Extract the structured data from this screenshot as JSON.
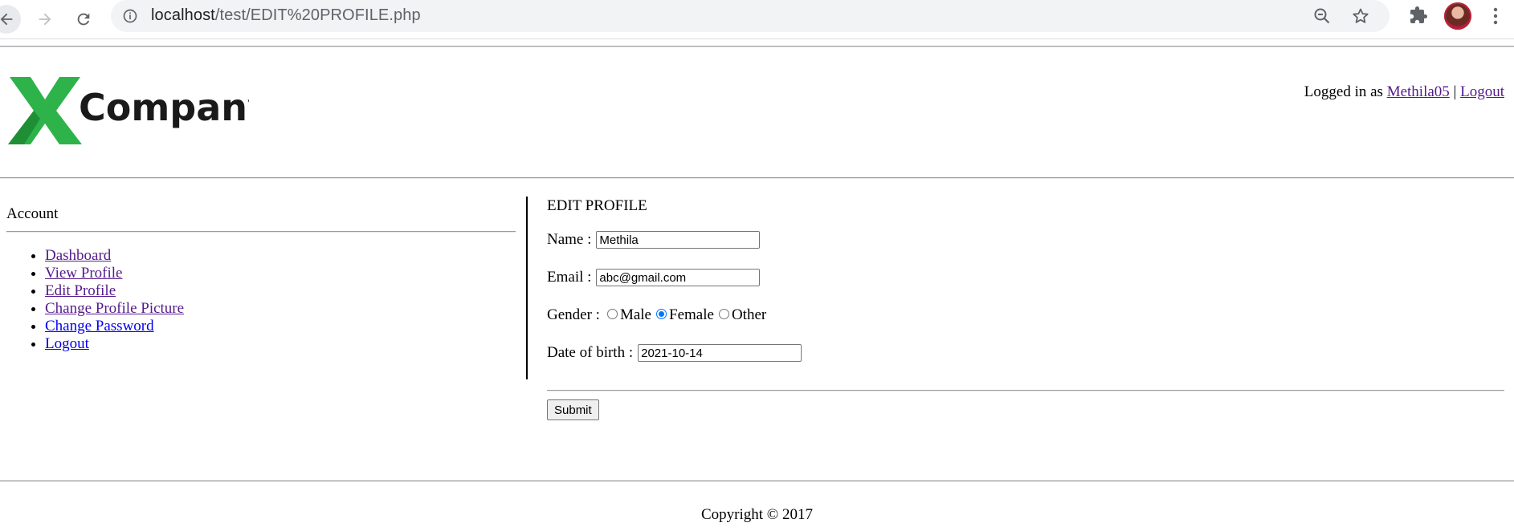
{
  "browser": {
    "url_host": "localhost",
    "url_path": "/test/EDIT%20PROFILE.php",
    "icons": [
      "back-arrow-icon",
      "forward-arrow-icon",
      "reload-icon",
      "info-icon",
      "zoom-out-icon",
      "star-icon",
      "extensions-icon",
      "profile-avatar",
      "menu-icon"
    ]
  },
  "header": {
    "logo_text": "Company",
    "logged_in_prefix": "Logged in as",
    "username": "Methila05",
    "separator": "|",
    "logout_label": "Logout"
  },
  "sidebar": {
    "title": "Account",
    "items": [
      {
        "label": "Dashboard"
      },
      {
        "label": "View Profile"
      },
      {
        "label": "Edit Profile"
      },
      {
        "label": "Change Profile Picture"
      },
      {
        "label": "Change Password"
      },
      {
        "label": "Logout"
      }
    ]
  },
  "form": {
    "title": "EDIT PROFILE",
    "name_label": "Name :",
    "name_value": "Methila",
    "email_label": "Email :",
    "email_value": "abc@gmail.com",
    "gender_label": "Gender :",
    "gender_options": [
      "Male",
      "Female",
      "Other"
    ],
    "gender_selected": "Female",
    "dob_label": "Date of birth :",
    "dob_value": "2021-10-14",
    "submit_label": "Submit"
  },
  "footer": {
    "copyright": "Copyright © 2017"
  },
  "colors": {
    "link_visited": "#551a8b",
    "link_unvisited": "#0000ee",
    "logo_green": "#2db34a",
    "radio_accent": "#0075ff"
  }
}
